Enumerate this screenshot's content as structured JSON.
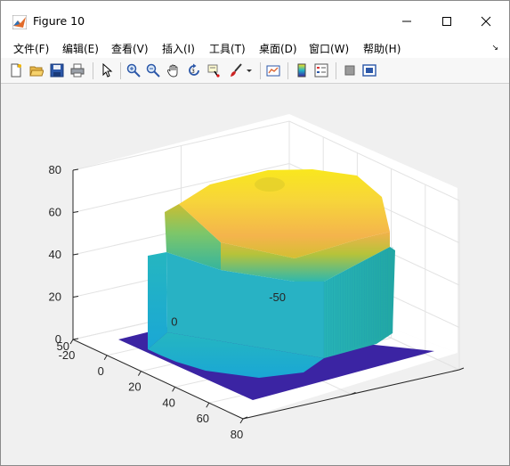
{
  "window": {
    "title": "Figure 10"
  },
  "menu": [
    "文件(F)",
    "编辑(E)",
    "查看(V)",
    "插入(I)",
    "工具(T)",
    "桌面(D)",
    "窗口(W)",
    "帮助(H)"
  ],
  "toolbar": {
    "buttons": [
      "new-figure",
      "open-file",
      "save",
      "print",
      "pointer",
      "zoom-in",
      "zoom-out",
      "pan",
      "rotate-3d",
      "data-cursor",
      "brush",
      "link-plot",
      "colorbar",
      "legend",
      "hide-plot-tools",
      "show-plot-tools"
    ]
  },
  "colors": {
    "base": "#3b24a3",
    "top": "#f9e71e",
    "side": "#1fb3c8"
  },
  "chart_data": {
    "type": "surface",
    "title": "",
    "xlabel": "",
    "ylabel": "",
    "zlabel": "",
    "x_ticks": [
      "-20",
      "0",
      "20",
      "40",
      "60",
      "80"
    ],
    "y_ticks": [
      "-50",
      "0",
      "50"
    ],
    "z_ticks": [
      "0",
      "20",
      "40",
      "60",
      "80"
    ],
    "xlim": [
      -20,
      80
    ],
    "ylim": [
      -50,
      50
    ],
    "zlim": [
      0,
      80
    ],
    "grid": true,
    "colormap": "parula",
    "surface": {
      "shape": "octagonal plateau",
      "base_z": 0,
      "side_top_z": 40,
      "plateau_z": 75,
      "center_dip_z": 72
    }
  }
}
